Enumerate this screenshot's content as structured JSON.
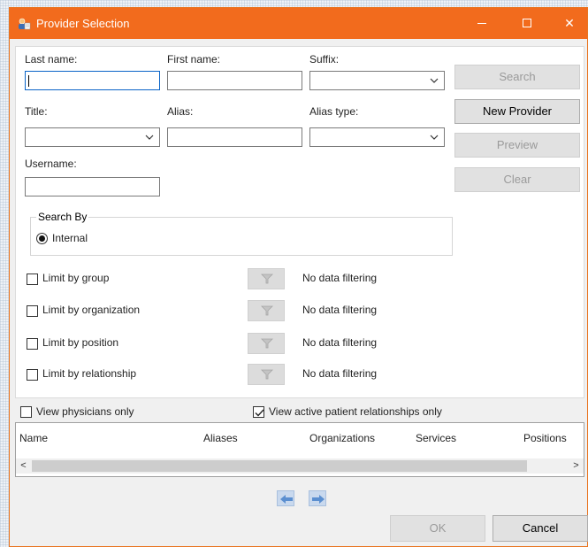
{
  "window": {
    "title": "Provider Selection",
    "minimize": "—",
    "maximize": "",
    "close": "✕"
  },
  "form": {
    "last_name_label": "Last name:",
    "first_name_label": "First name:",
    "suffix_label": "Suffix:",
    "title_label": "Title:",
    "alias_label": "Alias:",
    "alias_type_label": "Alias type:",
    "username_label": "Username:",
    "last_name_value": "",
    "first_name_value": "",
    "alias_value": "",
    "username_value": "",
    "suffix_value": "",
    "title_value": "",
    "alias_type_value": ""
  },
  "buttons": {
    "search": "Search",
    "new_provider": "New Provider",
    "preview": "Preview",
    "clear": "Clear",
    "ok": "OK",
    "cancel": "Cancel"
  },
  "search_by": {
    "legend": "Search By",
    "option": "Internal",
    "selected": true
  },
  "limits": [
    {
      "label": "Limit by group",
      "checked": false,
      "status": "No data filtering"
    },
    {
      "label": "Limit by organization",
      "checked": false,
      "status": "No data filtering"
    },
    {
      "label": "Limit by position",
      "checked": false,
      "status": "No data filtering"
    },
    {
      "label": "Limit by relationship",
      "checked": false,
      "status": "No data filtering"
    }
  ],
  "options": {
    "physicians_only": {
      "label": "View physicians only",
      "checked": false
    },
    "active_relationships": {
      "label": "View active patient relationships only",
      "checked": true
    }
  },
  "results_table": {
    "columns": [
      "Name",
      "Aliases",
      "Organizations",
      "Services",
      "Positions"
    ],
    "rows": []
  },
  "scroll": {
    "left": "<",
    "right": ">"
  },
  "icons": {
    "app": "provider-app-icon",
    "filter": "funnel-icon",
    "nav_prev": "arrow-left-icon",
    "nav_next": "arrow-right-icon"
  },
  "colors": {
    "titlebar": "#f26b1d",
    "nav_button": "#c9d9ee"
  }
}
